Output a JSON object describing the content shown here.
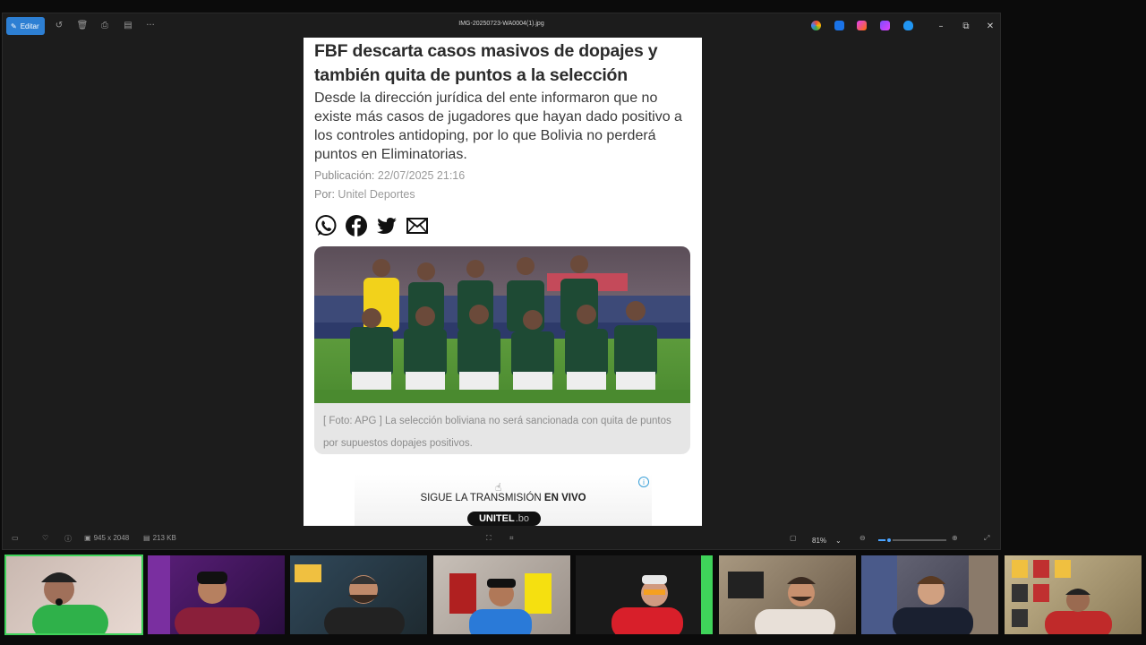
{
  "viewer": {
    "edit_label": "Editar",
    "file_title": "IMG-20250723-WA0004(1).jpg",
    "status": {
      "dimensions": "945 x 2048",
      "size": "213 KB",
      "zoom": "81%"
    }
  },
  "article": {
    "headline": "FBF descarta casos masivos de dopajes y también quita de puntos a la selección",
    "lead": "Desde la dirección jurídica del ente informaron que no existe más casos de jugadores que hayan dado positivo a los controles antidoping, por lo que Bolivia no perderá puntos en Eliminatorias.",
    "pub_label": "Publicación:",
    "pub_date": "22/07/2025 21:16",
    "by_label": "Por:",
    "by_author": "Unitel Deportes",
    "caption_source": "[ Foto: APG ]",
    "caption_text": " La selección boliviana no será sancionada con quita de puntos por supuestos dopajes positivos."
  },
  "ad": {
    "text_prefix": "SIGUE LA TRANSMISIÓN ",
    "text_bold": "EN VIVO",
    "logo": "UNITEL",
    "logo_suffix": ".bo"
  },
  "colors": {
    "accent": "#2d7fd3",
    "active_cam": "#3fd35a"
  },
  "icons": [
    "whatsapp-icon",
    "facebook-icon",
    "twitter-icon",
    "mail-icon"
  ]
}
